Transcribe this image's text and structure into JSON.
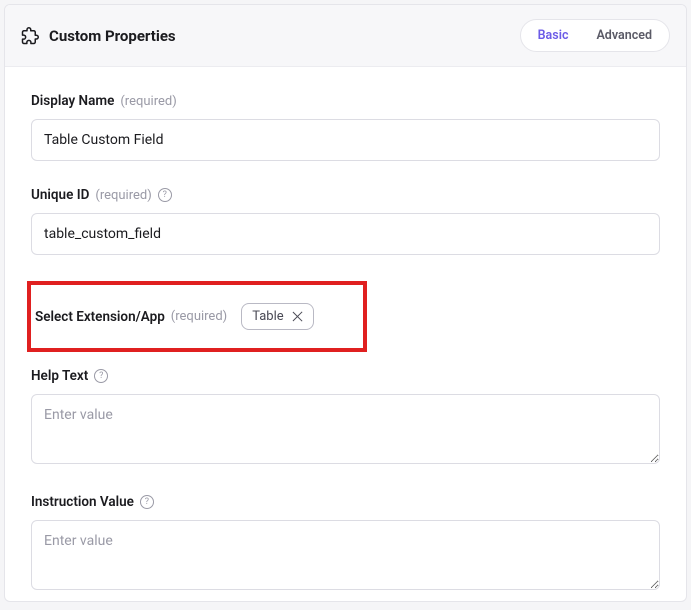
{
  "header": {
    "title": "Custom Properties",
    "tabs": {
      "basic": "Basic",
      "advanced": "Advanced"
    }
  },
  "fields": {
    "displayName": {
      "label": "Display Name",
      "required": "(required)",
      "value": "Table Custom Field"
    },
    "uniqueId": {
      "label": "Unique ID",
      "required": "(required)",
      "value": "table_custom_field"
    },
    "selectExtension": {
      "label": "Select Extension/App",
      "required": "(required)",
      "chip": "Table"
    },
    "helpText": {
      "label": "Help Text",
      "placeholder": "Enter value"
    },
    "instructionValue": {
      "label": "Instruction Value",
      "placeholder": "Enter value"
    }
  }
}
